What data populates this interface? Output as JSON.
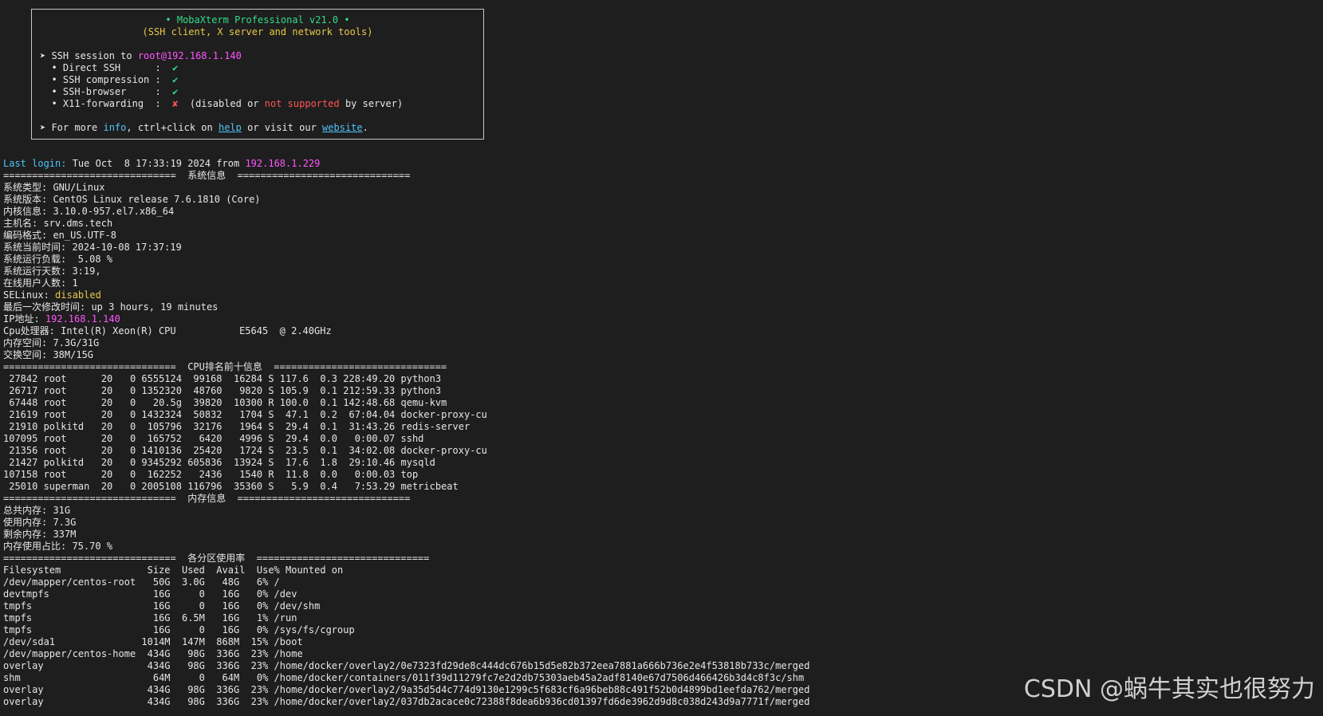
{
  "banner": {
    "title": "• MobaXterm Professional v21.0 •",
    "subtitle": "(SSH client, X server and network tools)",
    "ssh_prefix": "➤ SSH session to ",
    "ssh_target": "root@192.168.1.140",
    "features": [
      {
        "label": "  • Direct SSH      :  ",
        "mark": "✔"
      },
      {
        "label": "  • SSH compression :  ",
        "mark": "✔"
      },
      {
        "label": "  • SSH-browser     :  ",
        "mark": "✔"
      },
      {
        "label": "  • X11-forwarding  :  ",
        "mark": "✘"
      }
    ],
    "x11_note_a": "  (disabled ",
    "x11_note_or": "or",
    "x11_note_b": " not supported",
    "x11_note_c": " by server)",
    "info_prefix": "➤ For more ",
    "info_word": "info",
    "info_mid": ", ctrl+click on ",
    "help_link": "help",
    "visit_mid": " or visit our ",
    "website_link": "website",
    "period": "."
  },
  "last_login": {
    "label": "Last login:",
    "text": " Tue Oct  8 17:33:19 2024 from ",
    "ip": "192.168.1.229"
  },
  "sysinfo_header": "==============================  系统信息  ==============================",
  "sysinfo": [
    "系统类型: GNU/Linux",
    "系统版本: CentOS Linux release 7.6.1810 (Core)",
    "内核信息: 3.10.0-957.el7.x86_64",
    "主机名: srv.dms.tech",
    "编码格式: en_US.UTF-8",
    "系统当前时间: 2024-10-08 17:37:19",
    "系统运行负载:  5.08 %",
    "系统运行天数: 3:19,",
    "在线用户人数: 1"
  ],
  "selinux_label": "SELinux: ",
  "selinux_value": "disabled",
  "last_modified": "最后一次修改时间: up 3 hours, 19 minutes",
  "ip_label": "IP地址: ",
  "ip_value": "192.168.1.140",
  "cpu_line": "Cpu处理器: Intel(R) Xeon(R) CPU           E5645  @ 2.40GHz",
  "mem_space": "内存空间: 7.3G/31G",
  "swap_space": "交换空间: 38M/15G",
  "cpu_header": "==============================  CPU排名前十信息  ==============================",
  "cpu_rows": [
    " 27842 root      20   0 6555124  99168  16284 S 117.6  0.3 228:49.20 python3",
    " 26717 root      20   0 1352320  48760   9820 S 105.9  0.1 212:59.33 python3",
    " 67448 root      20   0   20.5g  39820  10300 R 100.0  0.1 142:48.68 qemu-kvm",
    " 21619 root      20   0 1432324  50832   1704 S  47.1  0.2  67:04.04 docker-proxy-cu",
    " 21910 polkitd   20   0  105796  32176   1964 S  29.4  0.1  31:43.26 redis-server",
    "107095 root      20   0  165752   6420   4996 S  29.4  0.0   0:00.07 sshd",
    " 21356 root      20   0 1410136  25420   1724 S  23.5  0.1  34:02.08 docker-proxy-cu",
    " 21427 polkitd   20   0 9345292 605836  13924 S  17.6  1.8  29:10.46 mysqld",
    "107158 root      20   0  162252   2436   1540 R  11.8  0.0   0:00.03 top",
    " 25010 superman  20   0 2005108 116796  35360 S   5.9  0.4   7:53.29 metricbeat"
  ],
  "mem_header": "==============================  内存信息  ==============================",
  "mem_rows": [
    "总共内存: 31G",
    "使用内存: 7.3G",
    "剩余内存: 337M",
    "内存使用占比: 75.70 %"
  ],
  "disk_header": "==============================  各分区使用率  ==============================",
  "disk_rows": [
    "Filesystem               Size  Used  Avail  Use% Mounted on",
    "/dev/mapper/centos-root   50G  3.0G   48G   6% /",
    "devtmpfs                  16G     0   16G   0% /dev",
    "tmpfs                     16G     0   16G   0% /dev/shm",
    "tmpfs                     16G  6.5M   16G   1% /run",
    "tmpfs                     16G     0   16G   0% /sys/fs/cgroup",
    "/dev/sda1               1014M  147M  868M  15% /boot",
    "/dev/mapper/centos-home  434G   98G  336G  23% /home",
    "overlay                  434G   98G  336G  23% /home/docker/overlay2/0e7323fd29de8c444dc676b15d5e82b372eea7881a666b736e2e4f53818b733c/merged",
    "shm                       64M     0   64M   0% /home/docker/containers/011f39d11279fc7e2d2db75303aeb45a2adf8140e67d7506d466426b3d4c8f3c/shm",
    "overlay                  434G   98G  336G  23% /home/docker/overlay2/9a35d5d4c774d9130e1299c5f683cf6a96beb88c491f52b0d4899bd1eefda762/merged",
    "overlay                  434G   98G  336G  23% /home/docker/overlay2/037db2acace0c72388f8dea6b936cd01397fd6de3962d9d8c038d243d9a7771f/merged"
  ],
  "watermark": "CSDN @蜗牛其实也很努力",
  "colors": {
    "background": "#1e1e1e",
    "text": "#e6e6e6",
    "green": "#33dd88",
    "yellow": "#e6c84a",
    "red": "#ff5555",
    "magenta": "#ff55ff",
    "cyan": "#4fc3f7"
  }
}
